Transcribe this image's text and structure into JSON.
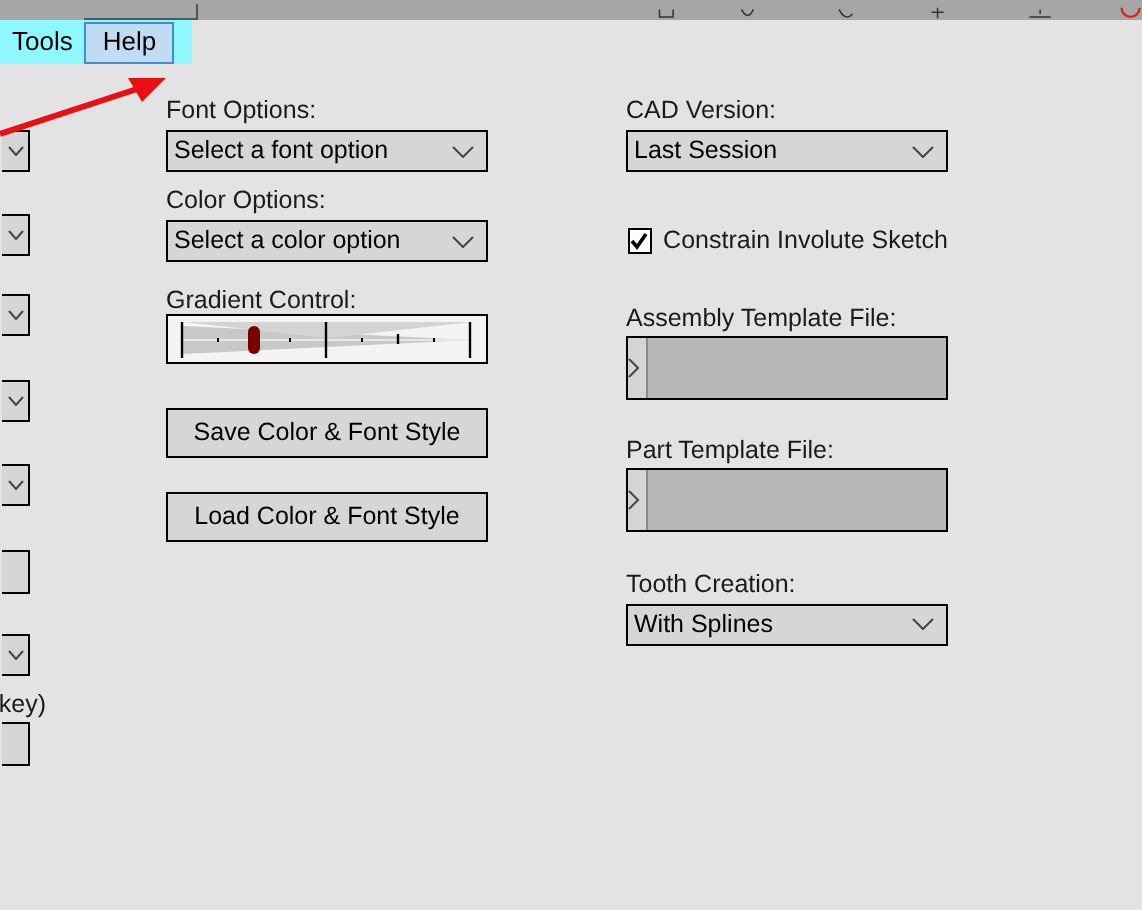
{
  "menu": [
    {
      "label": "Tools",
      "selected": false
    },
    {
      "label": "Help",
      "selected": true
    }
  ],
  "left_column": [
    {
      "kind": "dropdown"
    },
    {
      "kind": "dropdown"
    },
    {
      "kind": "dropdown"
    },
    {
      "kind": "dropdown"
    },
    {
      "kind": "dropdown"
    },
    {
      "kind": "box"
    },
    {
      "kind": "dropdown"
    },
    {
      "kind": "text",
      "text": "key)"
    },
    {
      "kind": "box"
    }
  ],
  "font_options": {
    "label": "Font Options:",
    "value": "Select a font option"
  },
  "color_options": {
    "label": "Color Options:",
    "value": "Select a color option"
  },
  "gradient_control": {
    "label": "Gradient Control:",
    "level": 0.25
  },
  "buttons": [
    "Save Color & Font Style",
    "Load Color & Font Style"
  ],
  "cad_version": {
    "label": "CAD Version:",
    "value": "Last Session"
  },
  "constrain_involute_sketch": {
    "label": "Constrain Involute Sketch",
    "checked": true
  },
  "assembly_template_file": {
    "label": "Assembly Template File:"
  },
  "part_template_file": {
    "label": "Part Template File:"
  },
  "tooth_creation": {
    "label": "Tooth Creation:",
    "value": "With Splines"
  }
}
